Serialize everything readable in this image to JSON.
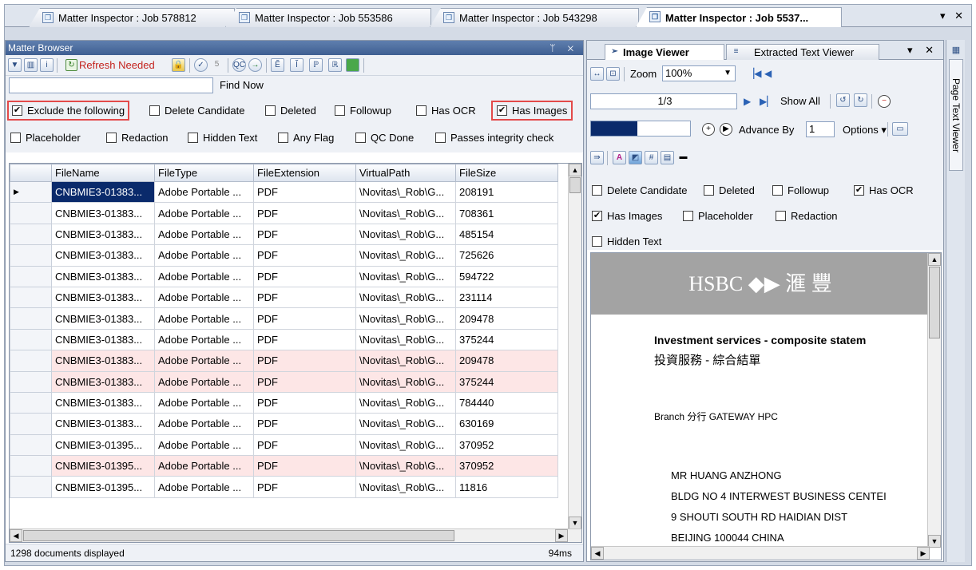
{
  "doc_tabs": [
    {
      "label": "Matter Inspector : Job 578812"
    },
    {
      "label": "Matter Inspector : Job 553586"
    },
    {
      "label": "Matter Inspector : Job 543298"
    },
    {
      "label": "Matter Inspector : Job 5537..."
    }
  ],
  "doc_tab_controls": "▾ ✕",
  "matter_browser": {
    "title": "Matter Browser",
    "pane_controls": "ᛘ ✕",
    "refresh_label": "Refresh Needed",
    "find_now_label": "Find Now",
    "search_value": "",
    "filters_row1": [
      {
        "label": "Exclude the following",
        "checked": true
      },
      {
        "label": "Delete Candidate",
        "checked": false
      },
      {
        "label": "Deleted",
        "checked": false
      },
      {
        "label": "Followup",
        "checked": false
      },
      {
        "label": "Has OCR",
        "checked": false
      },
      {
        "label": "Has Images",
        "checked": true
      }
    ],
    "filters_row2": [
      {
        "label": "Placeholder",
        "checked": false
      },
      {
        "label": "Redaction",
        "checked": false
      },
      {
        "label": "Hidden Text",
        "checked": false
      },
      {
        "label": "Any Flag",
        "checked": false
      },
      {
        "label": "QC Done",
        "checked": false
      },
      {
        "label": "Passes integrity check",
        "checked": false
      }
    ],
    "columns": [
      "FileName",
      "FileType",
      "FileExtension",
      "VirtualPath",
      "FileSize"
    ],
    "rows": [
      {
        "file_name": "CNBMIE3-01383...",
        "file_type": "Adobe Portable ...",
        "ext": "PDF",
        "path": "\\Novitas\\_Rob\\G...",
        "size": "208191",
        "highlight": false,
        "selected": true
      },
      {
        "file_name": "CNBMIE3-01383...",
        "file_type": "Adobe Portable ...",
        "ext": "PDF",
        "path": "\\Novitas\\_Rob\\G...",
        "size": "708361",
        "highlight": false
      },
      {
        "file_name": "CNBMIE3-01383...",
        "file_type": "Adobe Portable ...",
        "ext": "PDF",
        "path": "\\Novitas\\_Rob\\G...",
        "size": "485154",
        "highlight": false
      },
      {
        "file_name": "CNBMIE3-01383...",
        "file_type": "Adobe Portable ...",
        "ext": "PDF",
        "path": "\\Novitas\\_Rob\\G...",
        "size": "725626",
        "highlight": false
      },
      {
        "file_name": "CNBMIE3-01383...",
        "file_type": "Adobe Portable ...",
        "ext": "PDF",
        "path": "\\Novitas\\_Rob\\G...",
        "size": "594722",
        "highlight": false
      },
      {
        "file_name": "CNBMIE3-01383...",
        "file_type": "Adobe Portable ...",
        "ext": "PDF",
        "path": "\\Novitas\\_Rob\\G...",
        "size": "231114",
        "highlight": false
      },
      {
        "file_name": "CNBMIE3-01383...",
        "file_type": "Adobe Portable ...",
        "ext": "PDF",
        "path": "\\Novitas\\_Rob\\G...",
        "size": "209478",
        "highlight": false
      },
      {
        "file_name": "CNBMIE3-01383...",
        "file_type": "Adobe Portable ...",
        "ext": "PDF",
        "path": "\\Novitas\\_Rob\\G...",
        "size": "375244",
        "highlight": false
      },
      {
        "file_name": "CNBMIE3-01383...",
        "file_type": "Adobe Portable ...",
        "ext": "PDF",
        "path": "\\Novitas\\_Rob\\G...",
        "size": "209478",
        "highlight": true
      },
      {
        "file_name": "CNBMIE3-01383...",
        "file_type": "Adobe Portable ...",
        "ext": "PDF",
        "path": "\\Novitas\\_Rob\\G...",
        "size": "375244",
        "highlight": true
      },
      {
        "file_name": "CNBMIE3-01383...",
        "file_type": "Adobe Portable ...",
        "ext": "PDF",
        "path": "\\Novitas\\_Rob\\G...",
        "size": "784440",
        "highlight": false
      },
      {
        "file_name": "CNBMIE3-01383...",
        "file_type": "Adobe Portable ...",
        "ext": "PDF",
        "path": "\\Novitas\\_Rob\\G...",
        "size": "630169",
        "highlight": false
      },
      {
        "file_name": "CNBMIE3-01395...",
        "file_type": "Adobe Portable ...",
        "ext": "PDF",
        "path": "\\Novitas\\_Rob\\G...",
        "size": "370952",
        "highlight": false
      },
      {
        "file_name": "CNBMIE3-01395...",
        "file_type": "Adobe Portable ...",
        "ext": "PDF",
        "path": "\\Novitas\\_Rob\\G...",
        "size": "370952",
        "highlight": true
      },
      {
        "file_name": "CNBMIE3-01395...",
        "file_type": "Adobe Portable ...",
        "ext": "PDF",
        "path": "\\Novitas\\_Rob\\G...",
        "size": "11816",
        "highlight": false
      }
    ],
    "status_text": "1298 documents displayed",
    "elapsed": "94ms"
  },
  "image_viewer": {
    "tabs": [
      {
        "label": "Image Viewer"
      },
      {
        "label": "Extracted Text Viewer"
      }
    ],
    "pane_controls": "▾ ✕",
    "zoom_label": "Zoom",
    "zoom_value": "100%",
    "page_value": "1/3",
    "show_all_label": "Show All",
    "advance_label": "Advance By",
    "advance_value": "1",
    "options_label": "Options",
    "progress": 0.47,
    "checks_row1": [
      {
        "label": "Delete Candidate",
        "checked": false
      },
      {
        "label": "Deleted",
        "checked": false
      },
      {
        "label": "Followup",
        "checked": false
      },
      {
        "label": "Has OCR",
        "checked": true
      }
    ],
    "checks_row2": [
      {
        "label": "Has Images",
        "checked": true
      },
      {
        "label": "Placeholder",
        "checked": false
      },
      {
        "label": "Redaction",
        "checked": false
      }
    ],
    "checks_row3": [
      {
        "label": "Hidden Text",
        "checked": false
      }
    ],
    "document": {
      "bank_name": "HSBC ◆▶ 滙 豐",
      "heading": "Investment services - composite statem",
      "heading_cn": "投資服務 - 綜合結單",
      "branch": "Branch 分行   GATEWAY HPC",
      "address": [
        "MR HUANG ANZHONG",
        "BLDG NO 4 INTERWEST BUSINESS CENTEI",
        "9 SHOUTI SOUTH RD HAIDIAN DIST",
        "BEIJING 100044 CHINA"
      ]
    }
  },
  "side_tab": "Page Text Viewer",
  "colors": {
    "title_bar": "#4a6a9e",
    "selected": "#0a2a6b",
    "highlight_row": "#fde6e6",
    "callout": "#e34a4a"
  }
}
